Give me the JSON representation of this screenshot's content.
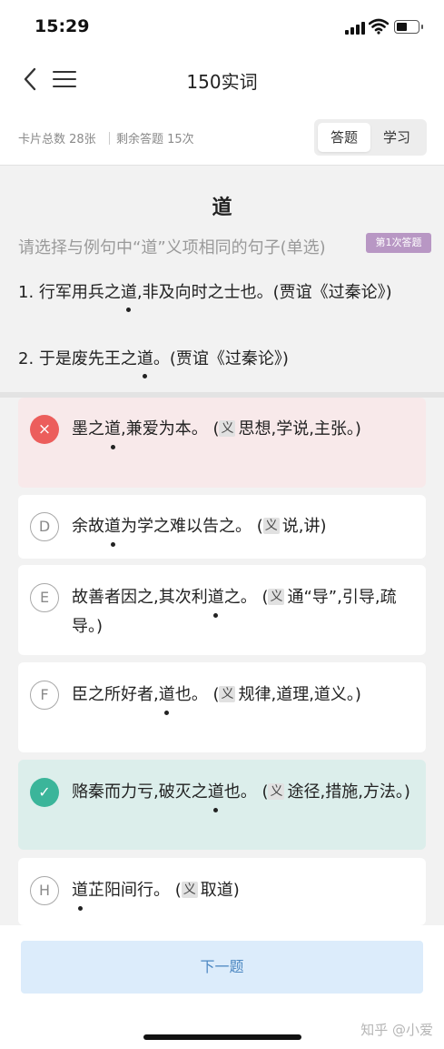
{
  "status": {
    "time": "15:29"
  },
  "nav": {
    "title": "150实词"
  },
  "stats": {
    "total": "卡片总数 28张",
    "remaining": "剩余答题 15次"
  },
  "mode": {
    "answer": "答题",
    "study": "学习"
  },
  "question": {
    "char": "道",
    "prompt": "请选择与例句中“道”义项相同的句子(单选)",
    "badge": "第1次答题",
    "examples": [
      {
        "before": "1. 行军用兵之",
        "key": "道",
        "after": ",非及向时之士也。(贾谊《过秦论》)"
      },
      {
        "before": "2. 于是废先王之",
        "key": "道",
        "after": "。(贾谊《过秦论》)"
      }
    ]
  },
  "options": [
    {
      "mark": "×",
      "before": "墨之",
      "key": "道",
      "after": ",兼爱为本。 (",
      "yi": "义",
      "meaning": "思想,学说,主张。)"
    },
    {
      "mark": "D",
      "before": "余故",
      "key": "道",
      "after": "为学之难以告之。 (",
      "yi": "义",
      "meaning": "说,讲)"
    },
    {
      "mark": "E",
      "before": "故善者因之,其次利",
      "key": "道",
      "after": "之。 (",
      "yi": "义",
      "meaning": "通“导”,引导,疏导。)"
    },
    {
      "mark": "F",
      "before": "臣之所好者,",
      "key": "道",
      "after": "也。 (",
      "yi": "义",
      "meaning": "规律,道理,道义。)"
    },
    {
      "mark": "✓",
      "before": "赂秦而力亏,破灭之",
      "key": "道",
      "after": "也。 (",
      "yi": "义",
      "meaning": "途径,措施,方法。)"
    },
    {
      "mark": "H",
      "before": "",
      "key": "道",
      "after": "芷阳间行。 (",
      "yi": "义",
      "meaning": "取道)"
    }
  ],
  "footer": {
    "next": "下一题",
    "watermark": "知乎 @小爱"
  },
  "colors": {
    "wrong_bg": "#f8e9ea",
    "correct_bg": "#dceeeb",
    "wrong_mark": "#ec5e5c",
    "correct_mark": "#3bb59a",
    "badge": "#b897c4",
    "next_bg": "#dcecfb"
  }
}
